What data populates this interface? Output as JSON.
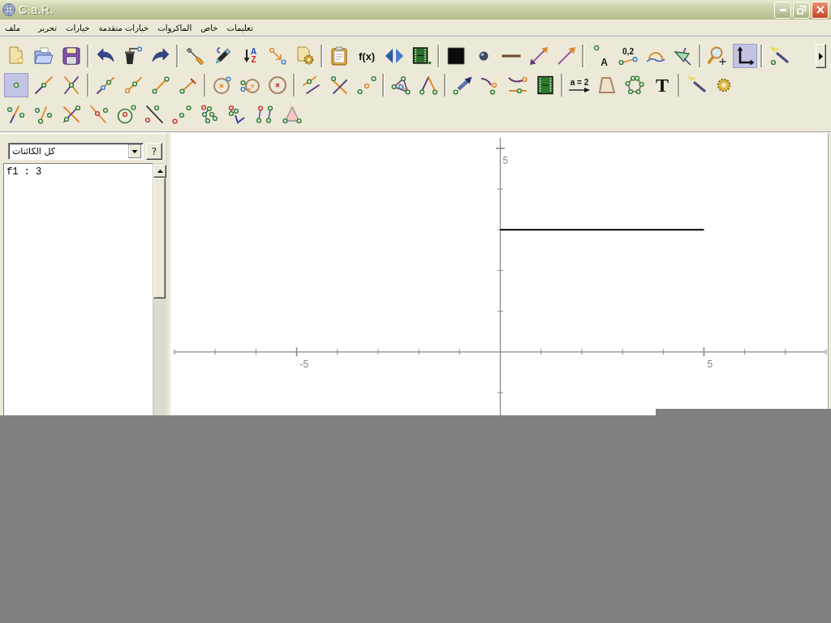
{
  "window": {
    "title": "C.a.R."
  },
  "menu": [
    "تعليمات",
    "خاص",
    "الماكروات",
    "خيارات متقدمة",
    "خيارات",
    "تحرير",
    "ملف"
  ],
  "toolbar": {
    "rows": [
      {
        "groups": [
          {
            "tools": [
              {
                "kind": "wandpoint",
                "selected": false
              }
            ]
          },
          {
            "tools": [
              {
                "kind": "axes",
                "selected": true
              },
              {
                "kind": "zoom",
                "selected": false
              }
            ]
          },
          {
            "tools": [
              {
                "kind": "hidden",
                "selected": false
              },
              {
                "kind": "arc",
                "selected": false
              },
              {
                "kind": "decimal",
                "label": "0,2",
                "selected": false
              },
              {
                "kind": "pointlabel",
                "label": "A",
                "selected": false
              }
            ]
          },
          {
            "tools": [
              {
                "kind": "arrow",
                "selected": false
              },
              {
                "kind": "doublearrow",
                "selected": false
              },
              {
                "kind": "thickness",
                "selected": false
              },
              {
                "kind": "sphere",
                "selected": false
              },
              {
                "kind": "fill",
                "selected": false
              }
            ]
          },
          {
            "tools": [
              {
                "kind": "film",
                "selected": false
              },
              {
                "kind": "flip",
                "selected": false
              },
              {
                "kind": "function",
                "label": "f(x)",
                "selected": false
              },
              {
                "kind": "clipboard",
                "selected": false
              }
            ]
          },
          {
            "tools": [
              {
                "kind": "settings",
                "selected": false
              },
              {
                "kind": "reorder",
                "selected": false
              },
              {
                "kind": "sort",
                "label": "A Z",
                "selected": false
              },
              {
                "kind": "color",
                "selected": false
              },
              {
                "kind": "edit",
                "selected": false
              }
            ]
          },
          {
            "tools": [
              {
                "kind": "redo",
                "selected": false
              },
              {
                "kind": "delete",
                "selected": false
              },
              {
                "kind": "undo",
                "selected": false
              }
            ]
          },
          {
            "tools": [
              {
                "kind": "save",
                "selected": false
              },
              {
                "kind": "open",
                "selected": false
              },
              {
                "kind": "new",
                "selected": false
              }
            ]
          }
        ]
      },
      {
        "groups": [
          {
            "tools": [
              {
                "kind": "gear",
                "selected": false
              },
              {
                "kind": "wand",
                "selected": false
              }
            ]
          },
          {
            "tools": [
              {
                "kind": "text",
                "label": "T",
                "selected": false
              },
              {
                "kind": "polygon",
                "selected": false
              },
              {
                "kind": "quad",
                "selected": false
              },
              {
                "kind": "expression",
                "label": "a = 2",
                "selected": false
              }
            ]
          },
          {
            "tools": [
              {
                "kind": "film2",
                "selected": false
              },
              {
                "kind": "curves",
                "selected": false
              },
              {
                "kind": "curve",
                "selected": false
              },
              {
                "kind": "vector",
                "selected": false
              }
            ]
          },
          {
            "tools": [
              {
                "kind": "angle",
                "selected": false
              },
              {
                "kind": "tricircle",
                "selected": false
              }
            ]
          },
          {
            "tools": [
              {
                "kind": "midpoint",
                "selected": false
              },
              {
                "kind": "perp",
                "selected": false
              },
              {
                "kind": "parallel",
                "selected": false
              }
            ]
          },
          {
            "tools": [
              {
                "kind": "fixcircle",
                "selected": false
              },
              {
                "kind": "circle3",
                "selected": false
              },
              {
                "kind": "circle",
                "selected": false
              }
            ]
          },
          {
            "tools": [
              {
                "kind": "fixseg",
                "selected": false
              },
              {
                "kind": "segment",
                "selected": false
              },
              {
                "kind": "ray",
                "selected": false
              },
              {
                "kind": "line",
                "selected": false
              }
            ]
          },
          {
            "tools": [
              {
                "kind": "intersection",
                "selected": false
              },
              {
                "kind": "pointon",
                "selected": false
              },
              {
                "kind": "point",
                "selected": true
              }
            ]
          }
        ]
      },
      {
        "groups": [
          {
            "tools": [
              {
                "kind": "filledtriangle",
                "selected": false
              },
              {
                "kind": "pairs",
                "selected": false
              },
              {
                "kind": "vshape",
                "selected": false
              },
              {
                "kind": "cluster",
                "selected": false
              },
              {
                "kind": "dots",
                "selected": false
              },
              {
                "kind": "diagonal",
                "selected": false
              },
              {
                "kind": "circlepoint",
                "selected": false
              },
              {
                "kind": "linepoint",
                "selected": false
              },
              {
                "kind": "crossing",
                "selected": false
              },
              {
                "kind": "slashpoints2",
                "selected": false
              },
              {
                "kind": "slashpoints",
                "selected": false
              }
            ]
          }
        ]
      }
    ]
  },
  "object_panel": {
    "filter": {
      "value": "كل الكائنات"
    },
    "help": "?",
    "objects": [
      "f1 : 3"
    ]
  },
  "canvas": {
    "y_axis_labels": [
      "5"
    ],
    "x_axis_labels": [
      "5",
      "-5"
    ]
  }
}
